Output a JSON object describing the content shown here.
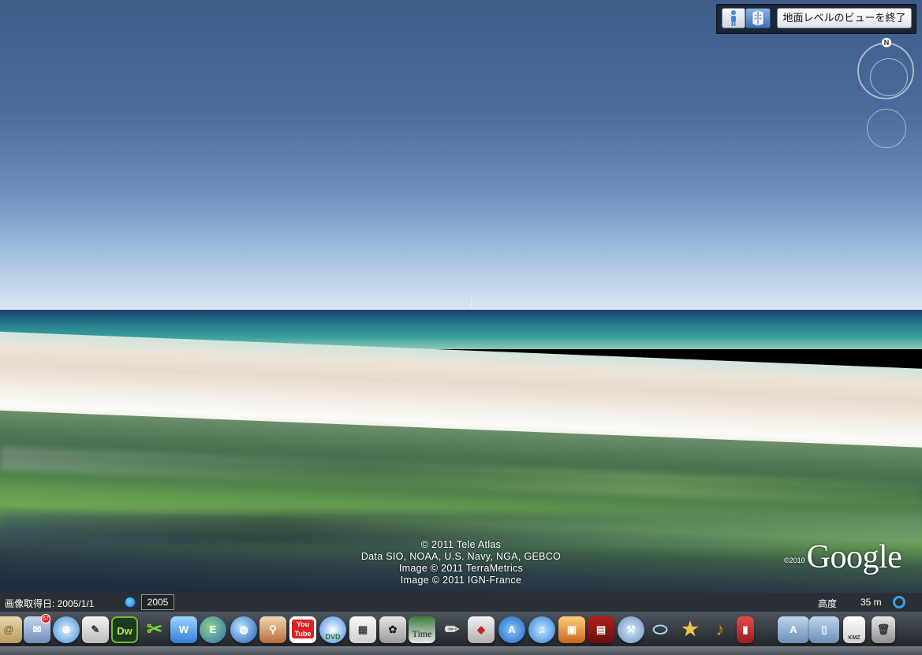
{
  "ground_view": {
    "exit_label": "地面レベルのビューを終了",
    "person_icon": "person-icon",
    "globe_icon": "globe-view-icon"
  },
  "navigation": {
    "north_label": "N"
  },
  "attribution": {
    "lines": [
      "© 2011 Tele Atlas",
      "Data SIO, NOAA, U.S. Navy, NGA, GEBCO",
      "Image © 2011 TerraMetrics",
      "Image © 2011 IGN-France"
    ]
  },
  "logo": {
    "year": "©2010",
    "name": "Google"
  },
  "status_bar": {
    "imagery_date": "画像取得日: 2005/1/1",
    "history_year": "2005",
    "altitude_label": "高度",
    "altitude_value": "35 m"
  },
  "dock": {
    "mail_badge": "67",
    "dreamweaver_label": "Dw",
    "youtube_label": "You Tube",
    "dvd_label": "DVD",
    "time_label": "Time",
    "kmz_label": "KMZ"
  },
  "colors": {
    "sky_top": "#3f5c8a",
    "sea": "#2a7f8e",
    "beach": "#f3ede4",
    "status_bar_bg": "#2a2f35",
    "altitude_ring": "#39a0dc"
  }
}
